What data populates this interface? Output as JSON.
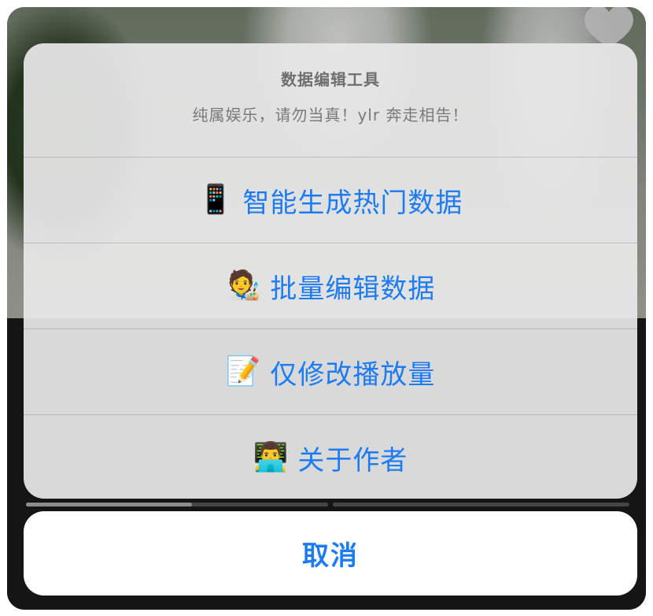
{
  "sheet": {
    "title": "数据编辑工具",
    "message": "纯属娱乐，请勿当真！ylr 奔走相告！",
    "actions": [
      {
        "emoji": "📱",
        "label": "智能生成热门数据"
      },
      {
        "emoji": "🧑‍🎨",
        "label": "批量编辑数据"
      },
      {
        "emoji": "📝",
        "label": "仅修改播放量"
      },
      {
        "emoji": "👨‍💻",
        "label": "关于作者"
      }
    ],
    "cancel_label": "取消"
  },
  "player": {
    "progress_fraction": 0.55
  },
  "icons": {
    "favorite": "heart-icon"
  },
  "colors": {
    "action_blue": "#1d7cf2"
  }
}
